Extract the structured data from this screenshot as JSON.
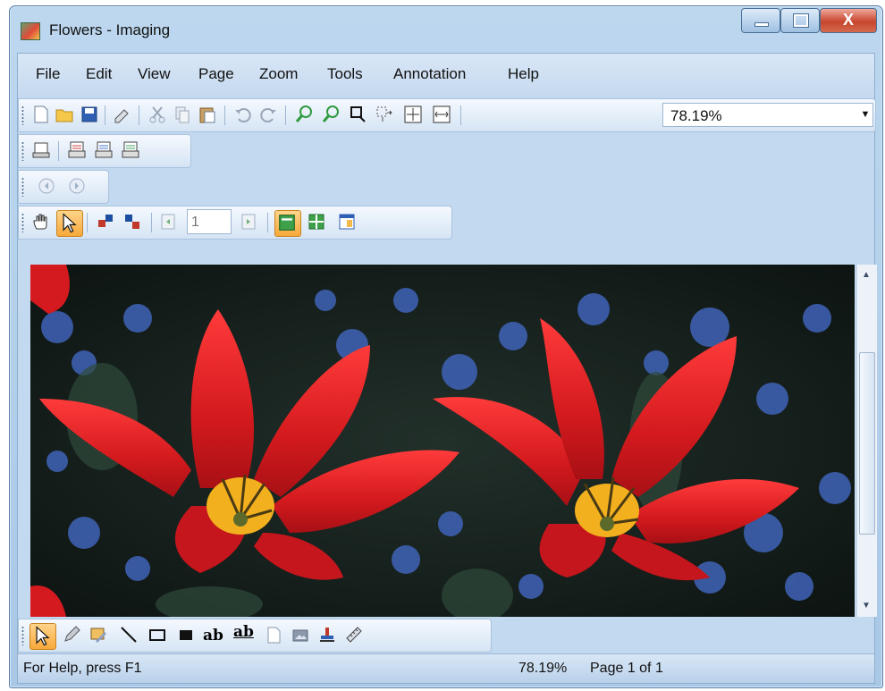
{
  "window": {
    "title": "Flowers - Imaging",
    "close_glyph": "X"
  },
  "menu": {
    "items": [
      "File",
      "Edit",
      "View",
      "Page",
      "Zoom",
      "Tools",
      "Annotation",
      "Help"
    ]
  },
  "toolbar_main": {
    "icons": [
      "new-icon",
      "open-icon",
      "save-icon",
      "clear-icon",
      "cut-icon",
      "copy-icon",
      "paste-icon",
      "undo-icon",
      "redo-icon",
      "zoom-in-icon",
      "zoom-out-icon",
      "zoom-rect-icon",
      "zoom-select-icon",
      "fit-page-icon",
      "fit-width-icon"
    ],
    "zoom_value": "78.19%"
  },
  "toolbar_print": {
    "icons": [
      "print-icon",
      "print-preview-icon",
      "print-setup-icon",
      "print-all-icon"
    ]
  },
  "toolbar_nav": {
    "icons": [
      "back-icon",
      "forward-icon"
    ]
  },
  "toolbar_view": {
    "icons": [
      "hand-icon",
      "pointer-icon",
      "rotate-icon",
      "flip-icon",
      "prev-page-icon",
      "next-page-icon",
      "single-page-icon",
      "thumbnail-icon",
      "window-icon"
    ],
    "page_value": "1"
  },
  "annotation_toolbar": {
    "tools": [
      "pointer-icon",
      "pen-icon",
      "highlighter-icon",
      "line-icon",
      "rectangle-icon",
      "filled-rectangle-icon",
      "text-icon",
      "text-box-icon",
      "note-icon",
      "image-icon",
      "stamp-icon",
      "ruler-icon"
    ],
    "text_label": "ab",
    "text_box_label": "ab"
  },
  "statusbar": {
    "help": "For Help, press F1",
    "zoom": "78.19%",
    "page": "Page 1 of 1"
  },
  "colors": {
    "accent": "#f7a93a",
    "frame": "#a9c8e6",
    "toolbar": "#d5e4f4"
  }
}
